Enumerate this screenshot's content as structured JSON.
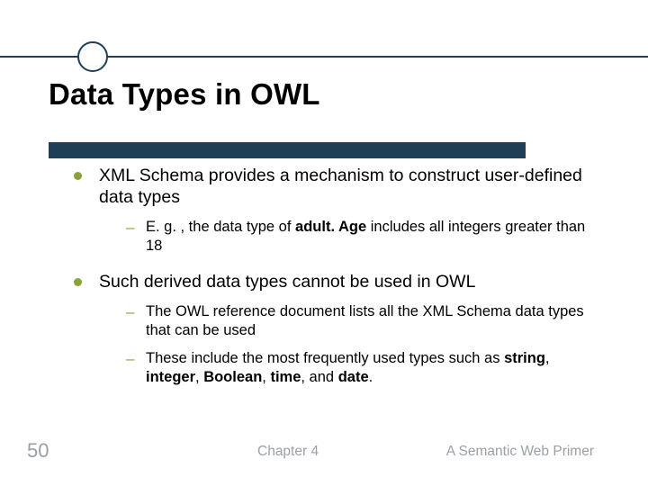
{
  "title": "Data Types in OWL",
  "b1": {
    "text": "XML Schema provides a mechanism to construct user-defined data types",
    "s1_pre": "E. g. , the data type of ",
    "s1_bold": "adult. Age",
    "s1_post": " includes all integers greater than 18"
  },
  "b2": {
    "text": "Such derived data types cannot be used in OWL",
    "s1": "The OWL reference document lists all the XML Schema data types that can be used",
    "s2_pre": "These include the most frequently used types such as ",
    "s2_b1": "string",
    "s2_m1": ", ",
    "s2_b2": "integer",
    "s2_m2": ", ",
    "s2_b3": "Boolean",
    "s2_m3": ", ",
    "s2_b4": "time",
    "s2_m4": ", and ",
    "s2_b5": "date",
    "s2_post": "."
  },
  "footer": {
    "page": "50",
    "mid": "Chapter 4",
    "right": "A Semantic Web Primer"
  }
}
